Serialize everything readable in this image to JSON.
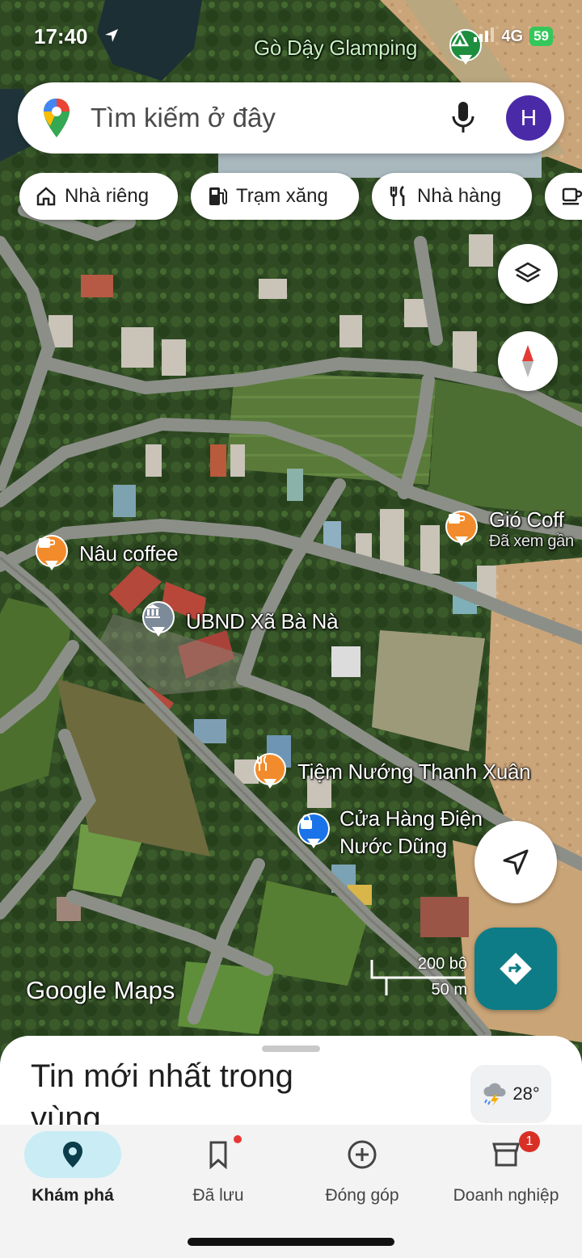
{
  "status": {
    "time": "17:40",
    "network": "4G",
    "battery": "59"
  },
  "search": {
    "placeholder": "Tìm kiếm ở đây",
    "avatar_letter": "H"
  },
  "chips": [
    {
      "label": "Nhà riêng",
      "icon": "home-icon"
    },
    {
      "label": "Trạm xăng",
      "icon": "gas-station-icon"
    },
    {
      "label": "Nhà hàng",
      "icon": "restaurant-icon"
    }
  ],
  "map": {
    "labels": {
      "glamping": "Gò Dậy Glamping",
      "gio_coffee": "Gió Coff",
      "gio_coffee_sub": "Đã xem gần",
      "nau_coffee": "Nâu coffee",
      "ubnd": "UBND Xã Bà Nà",
      "tiem_nuong": "Tiệm Nướng Thanh Xuân",
      "cua_hang_1": "Cửa Hàng Điện",
      "cua_hang_2": "Nước Dũng"
    },
    "poi_colors": {
      "food": "#f28b2b",
      "civic": "#7d8a99",
      "shop": "#1a73e8"
    },
    "watermark": "Google Maps",
    "scale_top": "200 bộ",
    "scale_bottom": "50 m"
  },
  "sheet": {
    "title": "Tin mới nhất trong vùng",
    "temperature": "28°"
  },
  "nav": [
    {
      "label": "Khám phá",
      "icon": "explore-pin-icon",
      "active": true
    },
    {
      "label": "Đã lưu",
      "icon": "bookmark-icon",
      "active": false
    },
    {
      "label": "Đóng góp",
      "icon": "add-circle-icon",
      "active": false
    },
    {
      "label": "Doanh nghiệp",
      "icon": "business-icon",
      "active": false,
      "badge": "1"
    }
  ]
}
